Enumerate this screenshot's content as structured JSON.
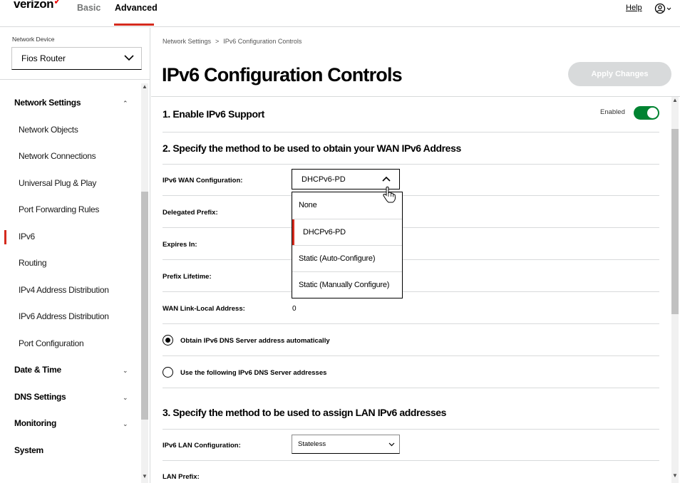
{
  "header": {
    "logo": "verizon",
    "tabs": [
      {
        "label": "Basic",
        "active": false
      },
      {
        "label": "Advanced",
        "active": true
      }
    ],
    "help_label": "Help",
    "accent_color": "#d52b1e"
  },
  "sidebar": {
    "device_label": "Network Device",
    "device_value": "Fios Router",
    "items": [
      {
        "label": "Network Settings",
        "type": "group",
        "expanded": true
      },
      {
        "label": "Network Objects",
        "type": "sub"
      },
      {
        "label": "Network Connections",
        "type": "sub"
      },
      {
        "label": "Universal Plug & Play",
        "type": "sub"
      },
      {
        "label": "Port Forwarding Rules",
        "type": "sub"
      },
      {
        "label": "IPv6",
        "type": "sub",
        "active": true
      },
      {
        "label": "Routing",
        "type": "sub"
      },
      {
        "label": "IPv4 Address Distribution",
        "type": "sub"
      },
      {
        "label": "IPv6 Address Distribution",
        "type": "sub"
      },
      {
        "label": "Port Configuration",
        "type": "sub"
      },
      {
        "label": "Date & Time",
        "type": "group",
        "expanded": false
      },
      {
        "label": "DNS Settings",
        "type": "group",
        "expanded": false
      },
      {
        "label": "Monitoring",
        "type": "group",
        "expanded": false
      },
      {
        "label": "System",
        "type": "group"
      }
    ]
  },
  "main": {
    "breadcrumb": [
      "Network Settings",
      "IPv6 Configuration Controls"
    ],
    "title": "IPv6 Configuration Controls",
    "apply_label": "Apply Changes",
    "section1": {
      "title": "1. Enable IPv6 Support",
      "toggle_label": "Enabled",
      "toggle_on": true,
      "toggle_color": "#008331"
    },
    "section2": {
      "title": "2. Specify the method to be used to obtain your WAN IPv6 Address",
      "wan_config_label": "IPv6 WAN Configuration:",
      "wan_config_value": "DHCPv6-PD",
      "wan_options": [
        "None",
        "DHCPv6-PD",
        "Static (Auto-Configure)",
        "Static (Manually Configure)"
      ],
      "delegated_prefix_label": "Delegated Prefix:",
      "expires_label": "Expires In:",
      "prefix_lifetime_label": "Prefix Lifetime:",
      "link_local_label": "WAN Link-Local Address:",
      "link_local_value": "0",
      "dns_auto_label": "Obtain IPv6 DNS Server address automatically",
      "dns_manual_label": "Use the following IPv6 DNS Server addresses"
    },
    "section3": {
      "title": "3. Specify the method to be used to assign LAN IPv6 addresses",
      "lan_config_label": "IPv6 LAN Configuration:",
      "lan_config_value": "Stateless",
      "lan_prefix_label": "LAN Prefix:"
    }
  }
}
